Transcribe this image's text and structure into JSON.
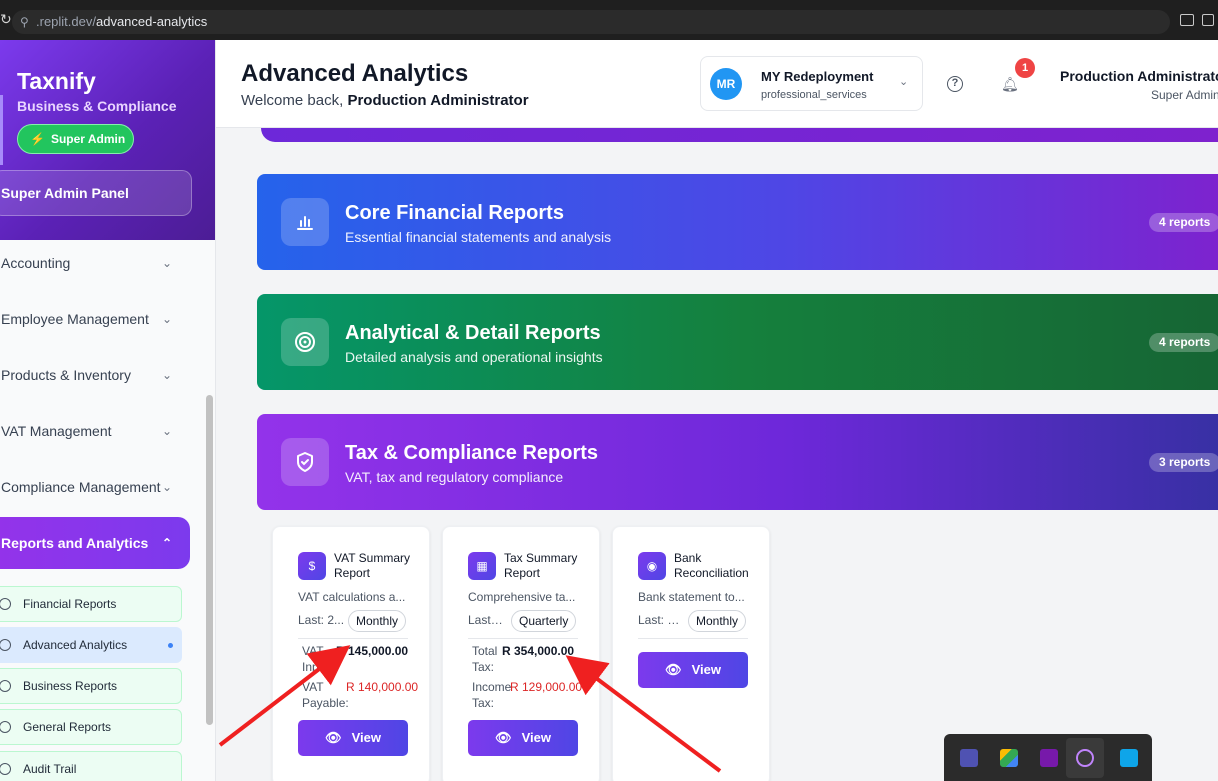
{
  "browser": {
    "url_prefix": ".replit.dev/",
    "url_path": "advanced-analytics"
  },
  "sidebar": {
    "brand": "Taxnify",
    "brand_sub": "Business & Compliance",
    "badge": "Super Admin",
    "panel_button": "Super Admin Panel",
    "nav": [
      {
        "label": "Accounting"
      },
      {
        "label": "Employee Management"
      },
      {
        "label": "Products & Inventory"
      },
      {
        "label": "VAT Management"
      },
      {
        "label": "Compliance Management"
      },
      {
        "label": "Reports and Analytics"
      }
    ],
    "sub": [
      {
        "label": "Financial Reports"
      },
      {
        "label": "Advanced Analytics"
      },
      {
        "label": "Business Reports"
      },
      {
        "label": "General Reports"
      },
      {
        "label": "Audit Trail"
      }
    ]
  },
  "header": {
    "title": "Advanced Analytics",
    "welcome_prefix": "Welcome back, ",
    "welcome_name": "Production Administrator",
    "workspace": {
      "initials": "MR",
      "name": "MY Redeployment",
      "type": "professional_services"
    },
    "notifications": "1",
    "user_name": "Production Administrator",
    "user_role": "Super Admin"
  },
  "categories": [
    {
      "title": "Core Financial Reports",
      "subtitle": "Essential financial statements and analysis",
      "count": "4 reports",
      "icon": "bar-chart-icon"
    },
    {
      "title": "Analytical & Detail Reports",
      "subtitle": "Detailed analysis and operational insights",
      "count": "4 reports",
      "icon": "target-icon"
    },
    {
      "title": "Tax & Compliance Reports",
      "subtitle": "VAT, tax and regulatory compliance",
      "count": "3 reports",
      "icon": "shield-icon"
    }
  ],
  "reports": [
    {
      "title": "VAT Summary Report",
      "desc": "VAT calculations a...",
      "last": "Last: 2...",
      "frequency": "Monthly",
      "metrics": [
        {
          "label": "VAT Input:",
          "value": "R 145,000.00"
        },
        {
          "label": "VAT Payable:",
          "value": "R 140,000.00"
        }
      ],
      "button": "View"
    },
    {
      "title": "Tax Summary Report",
      "desc": "Comprehensive ta...",
      "last": "Last: ...",
      "frequency": "Quarterly",
      "metrics": [
        {
          "label": "Total Tax:",
          "value": "R 354,000.00"
        },
        {
          "label": "Income Tax:",
          "value": "R 129,000.00"
        }
      ],
      "button": "View"
    },
    {
      "title": "Bank Reconciliation",
      "desc": "Bank statement to...",
      "last": "Last: 2...",
      "frequency": "Monthly",
      "metrics": [],
      "button": "View"
    }
  ]
}
